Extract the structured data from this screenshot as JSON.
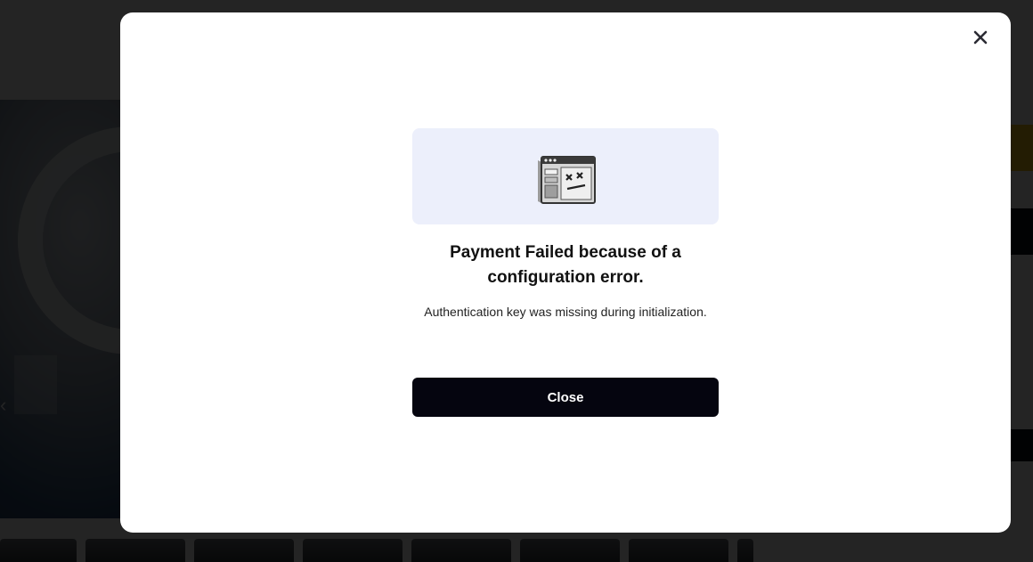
{
  "modal": {
    "close_icon": "close-icon",
    "illustration_icon": "error-window-icon",
    "headline": "Payment Failed because of a configuration error.",
    "message": "Authentication key was missing during initialization.",
    "close_button_label": "Close"
  },
  "colors": {
    "overlay": "#000000",
    "illustration_bg": "#eceffb",
    "primary_button": "#05050f",
    "accent_yellow": "#f5c518"
  }
}
